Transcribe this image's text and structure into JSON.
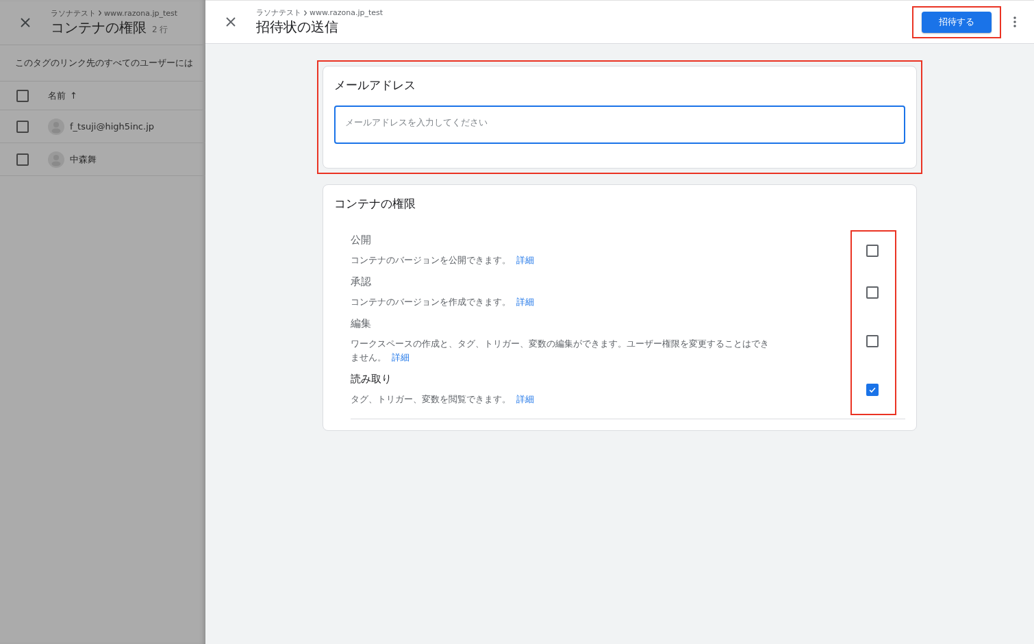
{
  "background_panel": {
    "breadcrumb": {
      "account": "ラソナテスト",
      "container": "www.razona.jp_test"
    },
    "title": "コンテナの権限",
    "row_count": "2 行",
    "description": "このタグのリンク先のすべてのユーザーには",
    "table": {
      "header": {
        "label": "名前",
        "sort_arrow": "↑",
        "checked": false
      },
      "rows": [
        {
          "name": "f_tsuji@high5inc.jp",
          "checked": false
        },
        {
          "name": "中森舞",
          "checked": false
        }
      ]
    }
  },
  "dialog": {
    "breadcrumb": {
      "account": "ラソナテスト",
      "container": "www.razona.jp_test"
    },
    "title": "招待状の送信",
    "invite_button": {
      "label": "招待する",
      "highlighted": true
    },
    "email_card": {
      "title": "メールアドレス",
      "placeholder": "メールアドレスを入力してください",
      "highlighted": true
    },
    "permissions_card": {
      "title": "コンテナの権限",
      "checkboxes_highlighted": true,
      "permissions": [
        {
          "title": "公開",
          "description": "コンテナのバージョンを公開できます。",
          "link": "詳細",
          "checked": false
        },
        {
          "title": "承認",
          "description": "コンテナのバージョンを作成できます。",
          "link": "詳細",
          "checked": false
        },
        {
          "title": "編集",
          "description": "ワークスペースの作成と、タグ、トリガー、変数の編集ができます。ユーザー権限を変更することはできません。",
          "link": "詳細",
          "checked": false
        },
        {
          "title": "読み取り",
          "description": "タグ、トリガー、変数を閲覧できます。",
          "link": "詳細",
          "checked": true
        }
      ]
    }
  }
}
